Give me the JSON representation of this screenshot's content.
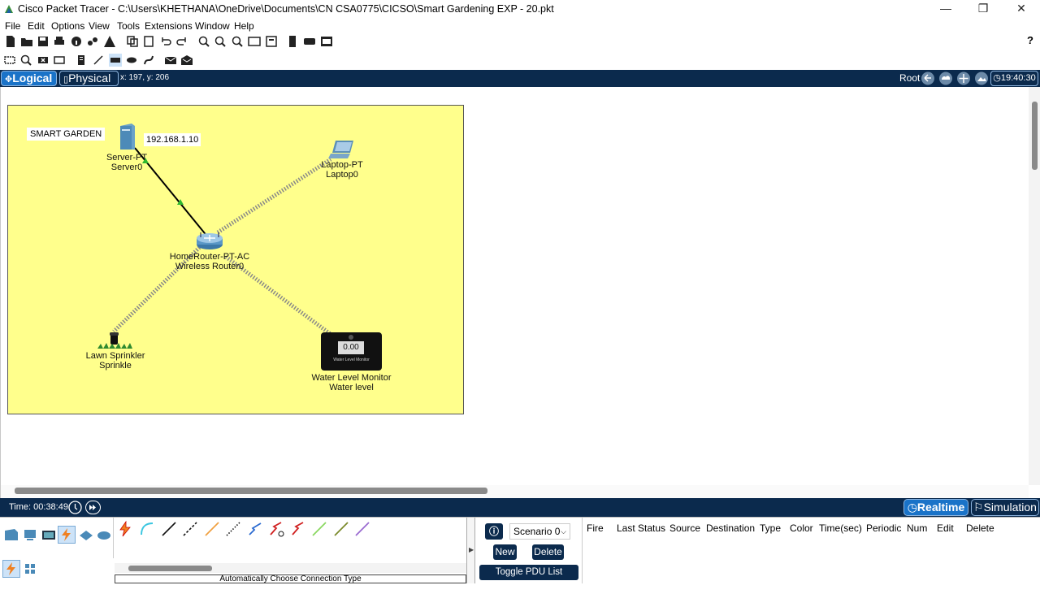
{
  "window": {
    "title": "Cisco Packet Tracer - C:\\Users\\KHETHANA\\OneDrive\\Documents\\CN CSA0775\\CICSO\\Smart Gardening EXP - 20.pkt",
    "minimize": "—",
    "restore": "❐",
    "close": "✕"
  },
  "menu": [
    "File",
    "Edit",
    "Options",
    "View",
    "Tools",
    "Extensions",
    "Window",
    "Help"
  ],
  "help_icon": "?",
  "workspace_bar": {
    "logical_label": "Logical",
    "physical_label": "Physical",
    "coords": "x: 197, y: 206",
    "root_label": "Root",
    "clock": "19:40:30"
  },
  "topology": {
    "cluster_label": "SMART GARDEN",
    "ip_note": "192.168.1.10",
    "devices": [
      {
        "id": "server",
        "model": "Server-PT",
        "name": "Server0"
      },
      {
        "id": "laptop",
        "model": "Laptop-PT",
        "name": "Laptop0"
      },
      {
        "id": "router",
        "model": "HomeRouter-PT-AC",
        "name": "Wireless Router0"
      },
      {
        "id": "sprinkler",
        "model": "Lawn Sprinkler",
        "name": "Sprinkle"
      },
      {
        "id": "monitor",
        "model": "Water Level Monitor",
        "name": "Water level",
        "reading": "0.00",
        "caption": "Water Level Monitor"
      }
    ]
  },
  "timebar": {
    "time": "Time: 00:38:49",
    "realtime_label": "Realtime",
    "simulation_label": "Simulation"
  },
  "bottom": {
    "connection_hint": "Automatically Choose Connection Type",
    "scenario": "Scenario 0",
    "new_label": "New",
    "delete_label": "Delete",
    "toggle_label": "Toggle PDU List Window",
    "pdu_headers": [
      "Fire",
      "Last Status",
      "Source",
      "Destination",
      "Type",
      "Color",
      "Time(sec)",
      "Periodic",
      "Num",
      "Edit",
      "Delete"
    ]
  },
  "colors": {
    "dark_bar": "#0b2a4d",
    "cluster_fill": "#ffff8c",
    "accent_blue": "#1a73c8"
  }
}
